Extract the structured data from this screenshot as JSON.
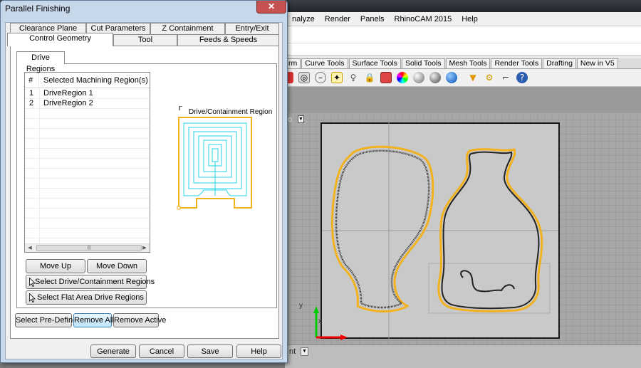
{
  "background_app": {
    "menu": [
      "nalyze",
      "Render",
      "Panels",
      "RhinoCAM 2015",
      "Help"
    ],
    "toolbar_tabs": [
      "rm",
      "Curve Tools",
      "Surface Tools",
      "Solid Tools",
      "Mesh Tools",
      "Render Tools",
      "Drafting",
      "New in V5"
    ],
    "viewport_label_fragment": "o",
    "status_fragment": "nt",
    "axis_y": "y",
    "axis_x": "x"
  },
  "dialog": {
    "title": "Parallel Finishing",
    "close_glyph": "✕",
    "tabs_row1": [
      "Clearance Plane",
      "Cut Parameters",
      "Z Containment",
      "Entry/Exit"
    ],
    "tabs_row2": [
      "Control Geometry",
      "Tool",
      "Feeds & Speeds"
    ],
    "active_tab": "Control Geometry",
    "subtab": "Drive Regions",
    "list": {
      "columns": [
        "#",
        "Selected Machining Region(s)"
      ],
      "rows": [
        {
          "num": "1",
          "name": "DriveRegion 1"
        },
        {
          "num": "2",
          "name": "DriveRegion 2"
        }
      ],
      "scroll_thumb_glyph": "|||"
    },
    "preview_label": "Drive/Containment Region",
    "buttons": {
      "move_up": "Move Up",
      "move_down": "Move Down",
      "select_drive": "Select Drive/Containment Regions",
      "select_flat": "Select Flat Area Drive Regions",
      "select_predefined": "Select Pre-Defined",
      "remove_all": "Remove All",
      "remove_active": "Remove Active",
      "generate": "Generate",
      "cancel": "Cancel",
      "save": "Save",
      "help": "Help"
    }
  },
  "colors": {
    "accent_yellow": "#f2b21e",
    "toolpath_cyan": "#22d3e6",
    "dialog_frame": "#c7d8ea",
    "close_red": "#c75050"
  }
}
